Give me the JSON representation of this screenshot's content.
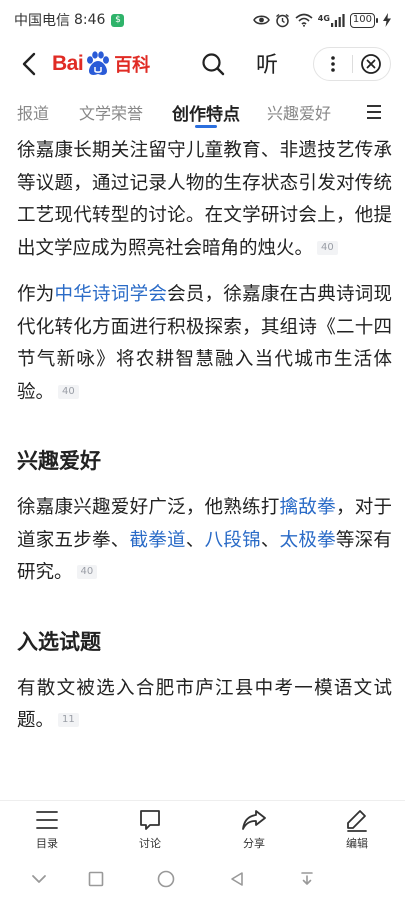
{
  "status_bar": {
    "carrier": "中国电信",
    "time": "8:46",
    "network": "4G",
    "battery": "100"
  },
  "top_bar": {
    "logo_bai": "Bai",
    "logo_baike": "百科",
    "listen_label": "听"
  },
  "tabs": [
    {
      "label": "报道"
    },
    {
      "label": "文学荣誉"
    },
    {
      "label": "创作特点"
    },
    {
      "label": "兴趣爱好"
    }
  ],
  "content": {
    "para1": {
      "text": "徐嘉康长期关注留守儿童教育、非遗技艺传承等议题，通过记录人物的生存状态引发对传统工艺现代转型的讨论。在文学研讨会上，他提出文学应成为照亮社会暗角的烛火。",
      "ref": "40"
    },
    "para2": {
      "pre": "作为",
      "link": "中华诗词学会",
      "post": "会员，徐嘉康在古典诗词现代化转化方面进行积极探索，其组诗《二十四节气新咏》将农耕智慧融入当代城市生活体验。",
      "ref": "40"
    },
    "section_hobbies": {
      "title": "兴趣爱好",
      "t1": "徐嘉康兴趣爱好广泛，他熟练打",
      "link1": "擒敌拳",
      "t2": "，对于道家五步拳、",
      "link2": "截拳道",
      "t3": "、",
      "link3": "八段锦",
      "t4": "、",
      "link4": "太极拳",
      "t5": "等深有研究。",
      "ref": "40"
    },
    "section_selected": {
      "title": "入选试题",
      "text": "有散文被选入合肥市庐江县中考一模语文试题。",
      "ref": "11"
    }
  },
  "toolbar": {
    "items": [
      {
        "label": "目录",
        "icon": "list-icon"
      },
      {
        "label": "讨论",
        "icon": "chat-icon"
      },
      {
        "label": "分享",
        "icon": "share-icon"
      },
      {
        "label": "编辑",
        "icon": "edit-icon"
      }
    ]
  },
  "colors": {
    "link": "#2a6bc7",
    "brand_red": "#e02b24",
    "brand_blue": "#2a5bd7",
    "tab_underline": "#2b6fde"
  }
}
